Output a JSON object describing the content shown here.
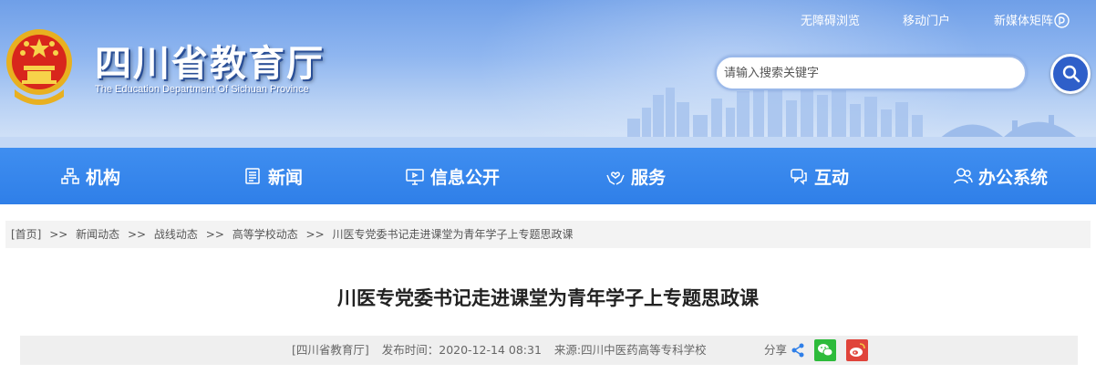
{
  "header": {
    "site_title": "四川省教育厅",
    "site_subtitle": "The Education Department Of Sichuan Province",
    "top_links": [
      "无障碍浏览",
      "移动门户",
      "新媒体矩阵"
    ],
    "search_placeholder": "请输入搜索关键字"
  },
  "nav": [
    {
      "label": "机构",
      "icon": "org-chart-icon"
    },
    {
      "label": "新闻",
      "icon": "newspaper-icon"
    },
    {
      "label": "信息公开",
      "icon": "monitor-icon"
    },
    {
      "label": "服务",
      "icon": "hands-heart-icon"
    },
    {
      "label": "互动",
      "icon": "chat-icon"
    },
    {
      "label": "办公系统",
      "icon": "users-icon"
    }
  ],
  "breadcrumb": [
    "[首页]",
    ">>",
    "新闻动态",
    ">>",
    "战线动态",
    ">>",
    "高等学校动态",
    ">>",
    "川医专党委书记走进课堂为青年学子上专题思政课"
  ],
  "article": {
    "title": "川医专党委书记走进课堂为青年学子上专题思政课",
    "source_tag": "[四川省教育厅]",
    "publish_time": "发布时间：2020-12-14 08:31",
    "origin": "来源:四川中医药高等专科学校",
    "share_label": "分享"
  },
  "colors": {
    "nav_bg": "#3a8aee",
    "search_button": "#2f5fc9",
    "wechat": "#2dbb3b",
    "weibo": "#e0443b"
  }
}
